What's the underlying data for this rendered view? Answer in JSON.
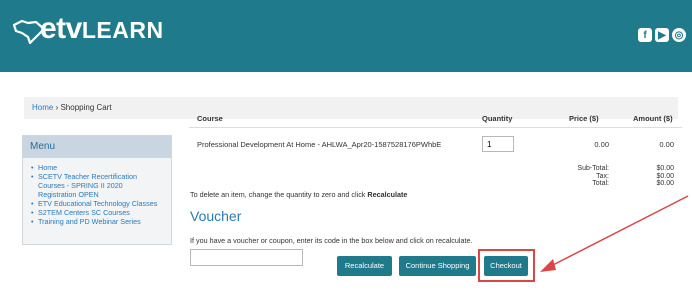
{
  "header": {
    "logo_main": "etv",
    "logo_sub": "LEARN",
    "social_icons": [
      "facebook-icon",
      "youtube-icon",
      "globe-icon"
    ],
    "bg_color": "#1f7a8c"
  },
  "breadcrumb": {
    "home": "Home",
    "separator": " › ",
    "current": "Shopping Cart"
  },
  "menu": {
    "title": "Menu",
    "items": [
      "Home",
      "SCETV Teacher Recertification Courses - SPRING II 2020 Registration OPEN",
      "ETV Educational Technology Classes",
      "S2TEM Centers SC Courses",
      "Training and PD Webinar Series"
    ]
  },
  "cart": {
    "headers": {
      "course": "Course",
      "quantity": "Quantity",
      "price": "Price ($)",
      "amount": "Amount ($)"
    },
    "item": {
      "name": "Professional Development At Home - AHLWA_Apr20-1587528176PWhbE",
      "quantity": "1",
      "price": "0.00",
      "amount": "0.00"
    },
    "totals": {
      "subtotal_label": "Sub-Total:",
      "subtotal": "$0.00",
      "tax_label": "Tax:",
      "tax": "$0.00",
      "total_label": "Total:",
      "total": "$0.00"
    },
    "delete_hint": "To delete an item, change the quantity to zero and click ",
    "delete_hint_bold": "Recalculate"
  },
  "voucher": {
    "title": "Voucher",
    "hint": "If you have a voucher or coupon, enter its code in the box below and click on recalculate.",
    "value": ""
  },
  "buttons": {
    "recalculate": "Recalculate",
    "continue": "Continue Shopping",
    "checkout": "Checkout"
  },
  "annotation_color": "#d94646"
}
